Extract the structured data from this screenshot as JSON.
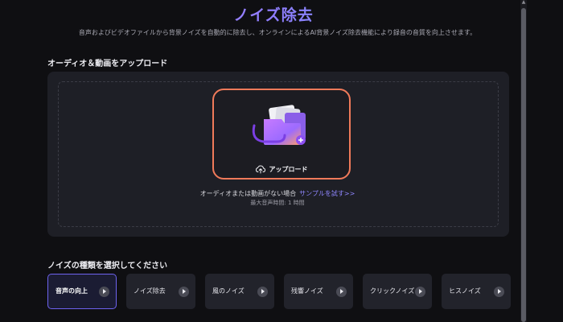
{
  "header": {
    "title": "ノイズ除去",
    "subtitle": "音声およびビデオファイルから背景ノイズを自動的に除去し、オンラインによるAI背景ノイズ除去機能により録音の音質を向上させます。"
  },
  "upload": {
    "section_label": "オーディオ＆動画をアップロード",
    "button_label": "アップロード",
    "no_file_text": "オーディオまたは動画がない場合",
    "sample_link": "サンプルを試す>>",
    "max_time": "最大音声時間: 1 時間"
  },
  "noise": {
    "section_label": "ノイズの種類を選択してください",
    "types": [
      {
        "label": "音声の向上",
        "active": true
      },
      {
        "label": "ノイズ除去",
        "active": false
      },
      {
        "label": "風のノイズ",
        "active": false
      },
      {
        "label": "残響ノイズ",
        "active": false
      },
      {
        "label": "クリックノイズ",
        "active": false
      },
      {
        "label": "ヒスノイズ",
        "active": false
      }
    ]
  },
  "colors": {
    "accent": "#6e63f0",
    "upload_border": "#f07a5a",
    "link": "#8f86ff"
  }
}
